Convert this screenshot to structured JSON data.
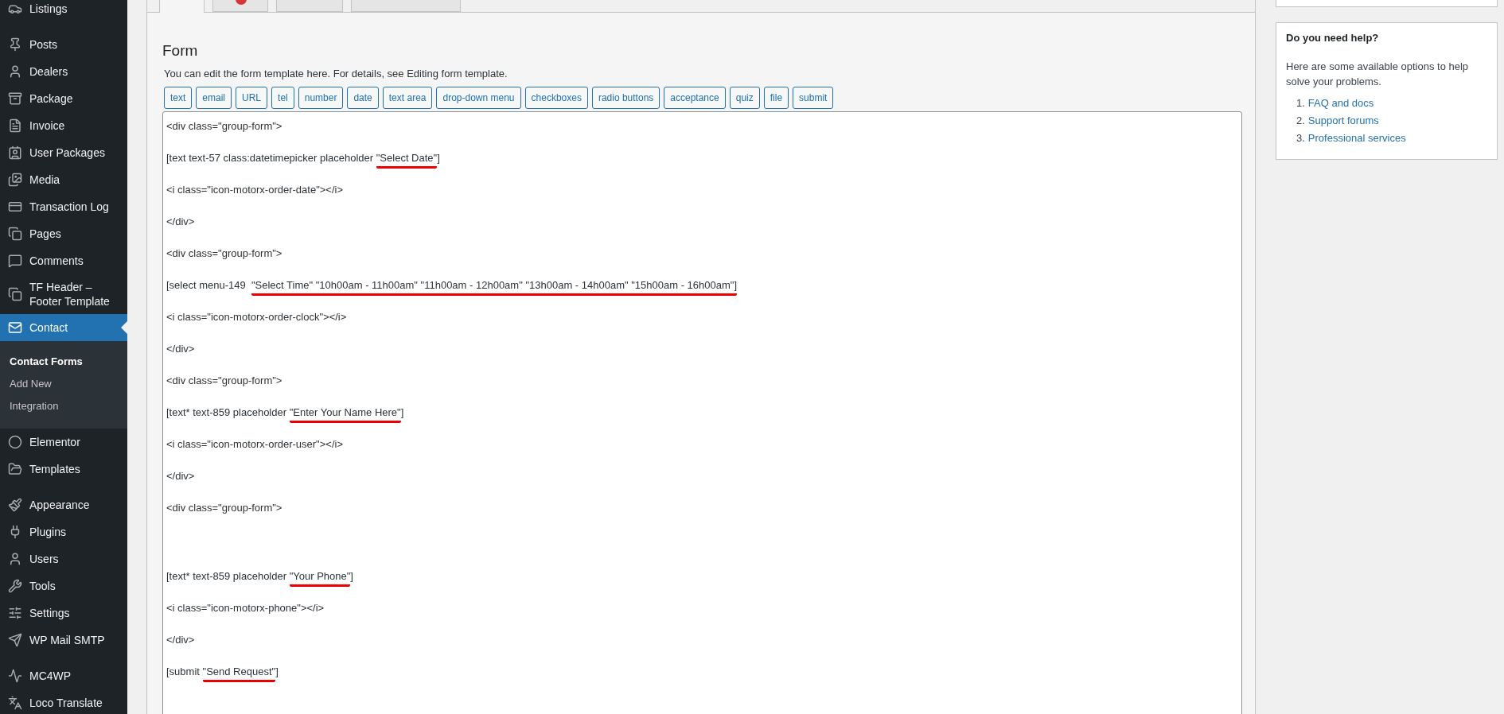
{
  "sidebar": {
    "items": [
      {
        "label": "Listings",
        "selected": false,
        "separator_before": false
      },
      {
        "label": "Posts",
        "selected": false,
        "separator_before": true
      },
      {
        "label": "Dealers",
        "selected": false,
        "separator_before": false
      },
      {
        "label": "Package",
        "selected": false,
        "separator_before": false
      },
      {
        "label": "Invoice",
        "selected": false,
        "separator_before": false
      },
      {
        "label": "User Packages",
        "selected": false,
        "separator_before": false
      },
      {
        "label": "Media",
        "selected": false,
        "separator_before": false
      },
      {
        "label": "Transaction Log",
        "selected": false,
        "separator_before": false
      },
      {
        "label": "Pages",
        "selected": false,
        "separator_before": false
      },
      {
        "label": "Comments",
        "selected": false,
        "separator_before": false
      },
      {
        "label": "TF Header – Footer Template",
        "selected": false,
        "separator_before": false
      },
      {
        "label": "Contact",
        "selected": true,
        "separator_before": false,
        "submenu": [
          {
            "label": "Contact Forms",
            "selected": true
          },
          {
            "label": "Add New",
            "selected": false
          },
          {
            "label": "Integration",
            "selected": false
          }
        ]
      },
      {
        "label": "Elementor",
        "selected": false,
        "separator_before": false
      },
      {
        "label": "Templates",
        "selected": false,
        "separator_before": false
      },
      {
        "label": "Appearance",
        "selected": false,
        "separator_before": true
      },
      {
        "label": "Plugins",
        "selected": false,
        "separator_before": false
      },
      {
        "label": "Users",
        "selected": false,
        "separator_before": false
      },
      {
        "label": "Tools",
        "selected": false,
        "separator_before": false
      },
      {
        "label": "Settings",
        "selected": false,
        "separator_before": false
      },
      {
        "label": "WP Mail SMTP",
        "selected": false,
        "separator_before": false
      },
      {
        "label": "MC4WP",
        "selected": false,
        "separator_before": true
      },
      {
        "label": "Loco Translate",
        "selected": false,
        "separator_before": false
      }
    ]
  },
  "tabs": [
    {
      "selected": true,
      "badge": false
    },
    {
      "selected": false,
      "badge": true
    },
    {
      "selected": false,
      "badge": false
    },
    {
      "selected": false,
      "badge": false
    }
  ],
  "form": {
    "title": "Form",
    "description": "You can edit the form template here. For details, see Editing form template.",
    "tag_buttons": [
      "text",
      "email",
      "URL",
      "tel",
      "number",
      "date",
      "text area",
      "drop-down menu",
      "checkboxes",
      "radio buttons",
      "acceptance",
      "quiz",
      "file",
      "submit"
    ],
    "code_lines": [
      {
        "text": "<div class=\"group-form\">",
        "extra_space_before": false
      },
      {
        "text": "[text text-57 class:datetimepicker placeholder ",
        "marked": "\"Select Date\"",
        "after": "]",
        "extra_space_before": false
      },
      {
        "text": "<i class=\"icon-motorx-order-date\"></i>",
        "extra_space_before": false
      },
      {
        "text": "</div>",
        "extra_space_before": false
      },
      {
        "text": "<div class=\"group-form\">",
        "extra_space_before": false
      },
      {
        "text": "[select menu-149  ",
        "marked": "\"Select Time\" \"10h00am - 11h00am\" \"11h00am - 12h00am\" \"13h00am - 14h00am\" \"15h00am - 16h00am\"]",
        "extra_space_before": false
      },
      {
        "text": "<i class=\"icon-motorx-order-clock\"></i>",
        "extra_space_before": false
      },
      {
        "text": "</div>",
        "extra_space_before": false
      },
      {
        "text": "<div class=\"group-form\">",
        "extra_space_before": false
      },
      {
        "text": "[text* text-859 placeholder ",
        "marked": "\"Enter Your Name Here\"",
        "after": "]",
        "extra_space_before": false
      },
      {
        "text": "<i class=\"icon-motorx-order-user\"></i>",
        "extra_space_before": false
      },
      {
        "text": "</div>",
        "extra_space_before": false
      },
      {
        "text": "<div class=\"group-form\">",
        "extra_space_before": false
      },
      {
        "text": "[text* text-859 placeholder ",
        "marked": "\"Your Phone\"",
        "after": "]",
        "extra_space_before": true
      },
      {
        "text": "<i class=\"icon-motorx-phone\"></i>",
        "extra_space_before": false
      },
      {
        "text": "</div>",
        "extra_space_before": false
      },
      {
        "text": "[submit ",
        "marked": "\"Send Request\"",
        "after": "]",
        "extra_space_before": false
      }
    ]
  },
  "help": {
    "title": "Do you need help?",
    "text": "Here are some available options to help solve your problems.",
    "links": [
      {
        "number": "1.",
        "label": "FAQ and docs"
      },
      {
        "number": "2.",
        "label": "Support forums"
      },
      {
        "number": "3.",
        "label": "Professional services"
      }
    ]
  }
}
